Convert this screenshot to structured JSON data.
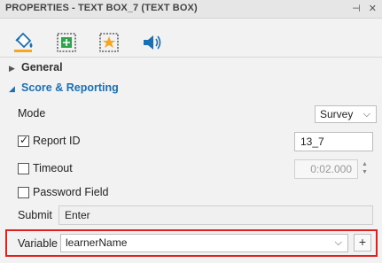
{
  "panel": {
    "title": "PROPERTIES - TEXT BOX_7 (TEXT BOX)",
    "pin_icon": "pin-icon",
    "close_icon": "close-icon"
  },
  "tabs": [
    {
      "name": "fill-tab",
      "icon": "paint-bucket-icon"
    },
    {
      "name": "size-tab",
      "icon": "resize-icon"
    },
    {
      "name": "star-tab",
      "icon": "star-icon"
    },
    {
      "name": "audio-tab",
      "icon": "speaker-icon"
    }
  ],
  "sections": {
    "general": "General",
    "score": "Score & Reporting"
  },
  "fields": {
    "mode_label": "Mode",
    "mode_value": "Survey",
    "report_id_label": "Report ID",
    "report_id_value": "13_7",
    "report_id_checked": true,
    "timeout_label": "Timeout",
    "timeout_value": "0:02.000",
    "timeout_checked": false,
    "password_label": "Password Field",
    "password_checked": false,
    "submit_label": "Submit",
    "submit_value": "Enter",
    "variable_label": "Variable",
    "variable_value": "learnerName",
    "add_label": "+"
  },
  "colors": {
    "accent": "#1a6fb5",
    "highlight": "#e02020"
  }
}
